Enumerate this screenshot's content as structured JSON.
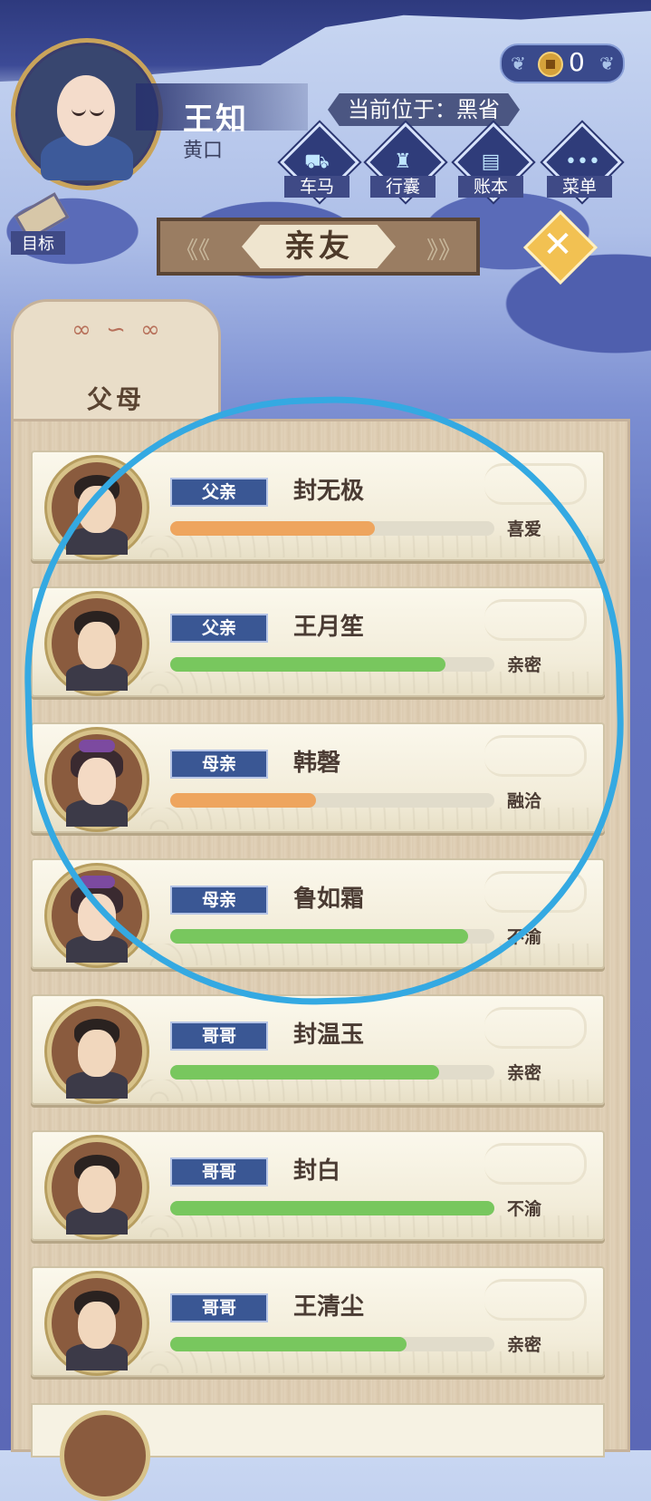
{
  "header": {
    "player_name": "王知",
    "player_title": "黄口",
    "location": "当前位于：黑省",
    "coins": "0"
  },
  "menu": [
    {
      "label": "车马",
      "icon": "carriage-icon"
    },
    {
      "label": "行囊",
      "icon": "bag-icon"
    },
    {
      "label": "账本",
      "icon": "ledger-icon"
    },
    {
      "label": "菜单",
      "icon": "more-icon"
    }
  ],
  "target_label": "目标",
  "title": "亲友",
  "tab_label": "父母",
  "colors": {
    "orange": "#eea55e",
    "green": "#78c75e",
    "highlight": "#34a9e2",
    "badge": "#3a5794"
  },
  "members": [
    {
      "role": "父亲",
      "name": "封无极",
      "relation": "喜爱",
      "level": 0.63,
      "bar_color": "orange",
      "gender": "male"
    },
    {
      "role": "父亲",
      "name": "王月笙",
      "relation": "亲密",
      "level": 0.85,
      "bar_color": "green",
      "gender": "male"
    },
    {
      "role": "母亲",
      "name": "韩磬",
      "relation": "融洽",
      "level": 0.45,
      "bar_color": "orange",
      "gender": "female"
    },
    {
      "role": "母亲",
      "name": "鲁如霜",
      "relation": "不渝",
      "level": 0.92,
      "bar_color": "green",
      "gender": "female"
    },
    {
      "role": "哥哥",
      "name": "封温玉",
      "relation": "亲密",
      "level": 0.83,
      "bar_color": "green",
      "gender": "male"
    },
    {
      "role": "哥哥",
      "name": "封白",
      "relation": "不渝",
      "level": 1.0,
      "bar_color": "green",
      "gender": "male"
    },
    {
      "role": "哥哥",
      "name": "王清尘",
      "relation": "亲密",
      "level": 0.73,
      "bar_color": "green",
      "gender": "male"
    }
  ]
}
